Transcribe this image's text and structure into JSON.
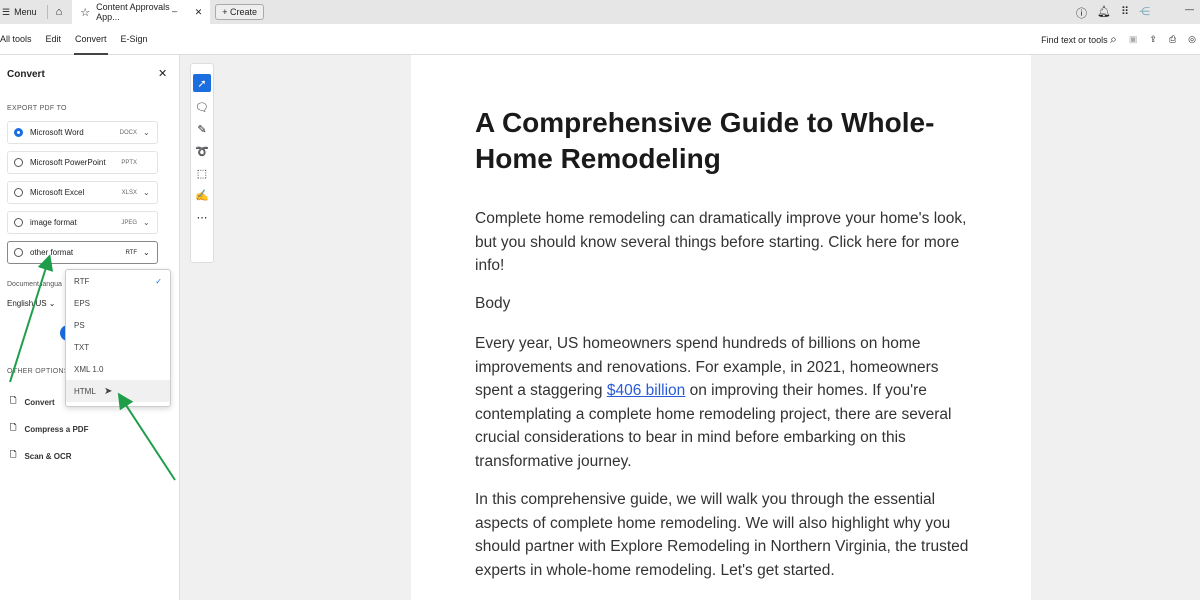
{
  "topbar": {
    "menu": "Menu",
    "tab_title": "Content Approvals _ App...",
    "create": "Create"
  },
  "toolbar": {
    "tabs": [
      "All tools",
      "Edit",
      "Convert",
      "E-Sign"
    ],
    "active": "Convert",
    "find": "Find text or tools"
  },
  "panel": {
    "title": "Convert",
    "export_label": "EXPORT PDF TO",
    "options": [
      {
        "label": "Microsoft Word",
        "ext": "DOCX",
        "selected": true
      },
      {
        "label": "Microsoft PowerPoint",
        "ext": "PPTX",
        "selected": false
      },
      {
        "label": "Microsoft Excel",
        "ext": "XLSX",
        "selected": false
      },
      {
        "label": "image format",
        "ext": "JPEG",
        "selected": false
      },
      {
        "label": "other format",
        "ext": "RTF",
        "selected": false
      }
    ],
    "doc_language_label": "Document langua",
    "language": "English US",
    "other_options_label": "OTHER OPTIONS",
    "other_options": [
      "Convert",
      "Compress a PDF",
      "Scan & OCR"
    ]
  },
  "dropdown": {
    "items": [
      "RTF",
      "EPS",
      "PS",
      "TXT",
      "XML 1.0",
      "HTML"
    ],
    "checked": "RTF",
    "hovered": "HTML"
  },
  "document": {
    "title": "A Comprehensive Guide to Whole-Home Remodeling",
    "intro": "Complete home remodeling can dramatically improve your home's look, but you should know several things before starting. Click here for more info!",
    "section": "Body",
    "p1_a": "Every year, US homeowners spend hundreds of billions on home improvements and renovations. For example, in 2021, homeowners spent a staggering ",
    "p1_link": "$406 billion",
    "p1_b": " on improving their homes. If you're contemplating a complete home remodeling project, there are several crucial considerations to bear in mind before embarking on this transformative journey.",
    "p2": "In this comprehensive guide, we will walk you through the essential aspects of complete home remodeling. We will also highlight why you should partner with Explore Remodeling in Northern Virginia, the trusted experts in whole-home remodeling. Let's get started."
  },
  "colors": {
    "accent": "#1a6ee0",
    "annotation_arrow": "#1f9e4a",
    "link": "#2a5bd7"
  }
}
